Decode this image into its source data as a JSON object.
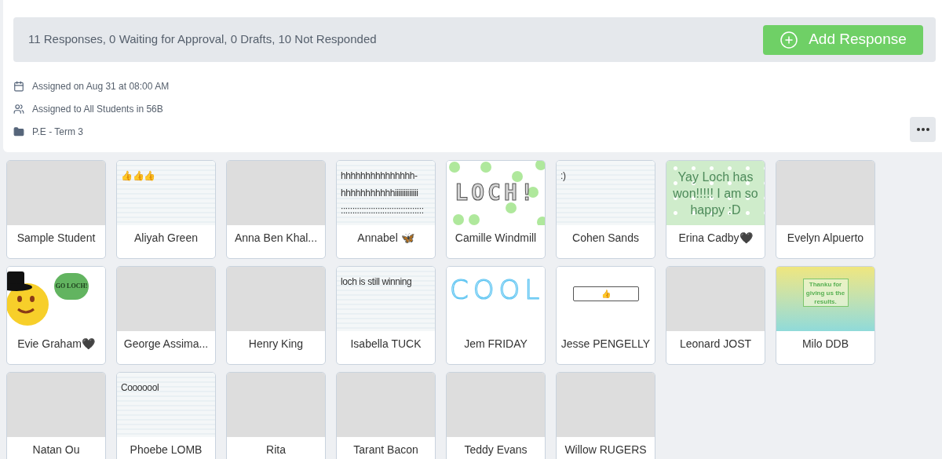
{
  "summary": {
    "text": "11 Responses, 0 Waiting for Approval, 0 Drafts, 10 Not Responded",
    "add_button": "Add Response"
  },
  "meta": [
    {
      "kind": "calendar",
      "text": "Assigned on Aug 31 at 08:00 AM"
    },
    {
      "kind": "people",
      "text": "Assigned to All Students in 56B"
    },
    {
      "kind": "folder",
      "text": "P.E - Term 3"
    }
  ],
  "responses": [
    {
      "name": "Sample Student",
      "thumb": {
        "kind": "blank"
      }
    },
    {
      "name": "Aliyah Green",
      "thumb": {
        "kind": "lined",
        "lines": [
          "👍👍👍"
        ]
      }
    },
    {
      "name": "Anna Ben Khal...",
      "thumb": {
        "kind": "blank"
      }
    },
    {
      "name": "Annabel 🦋",
      "thumb": {
        "kind": "lined",
        "lines": [
          "hhhhhhhhhhhhhhh-",
          "hhhhhhhhhhhiiiiiiiiiiiii",
          "::::::::::::::::::::::::::::::::::::"
        ]
      }
    },
    {
      "name": "Camille Windmill",
      "thumb": {
        "kind": "bubbles",
        "text": "LOCH!"
      }
    },
    {
      "name": "Cohen Sands",
      "thumb": {
        "kind": "lined",
        "lines": [
          ":)"
        ]
      }
    },
    {
      "name": "Erina Cadby🖤",
      "thumb": {
        "kind": "snow",
        "text": "Yay Loch has won!!!!! I am so happy :D"
      }
    },
    {
      "name": "Evelyn Alpuerto",
      "thumb": {
        "kind": "blank"
      }
    },
    {
      "name": "Evie Graham🖤",
      "thumb": {
        "kind": "smiley",
        "text": "GO LOCH!"
      }
    },
    {
      "name": "George Assima...",
      "thumb": {
        "kind": "blank"
      }
    },
    {
      "name": "Henry King",
      "thumb": {
        "kind": "blank"
      }
    },
    {
      "name": "Isabella TUCK",
      "thumb": {
        "kind": "lined",
        "lines": [
          "loch is still winning"
        ]
      }
    },
    {
      "name": "Jem FRIDAY",
      "thumb": {
        "kind": "handwriting",
        "text": "COOL"
      }
    },
    {
      "name": "Jesse PENGELLY",
      "thumb": {
        "kind": "boxed",
        "text": "👍"
      }
    },
    {
      "name": "Leonard JOST",
      "thumb": {
        "kind": "blank"
      }
    },
    {
      "name": "Milo DDB",
      "thumb": {
        "kind": "gradient",
        "text": "Thanku for giving us the results."
      }
    },
    {
      "name": "Natan Ou",
      "thumb": {
        "kind": "blank"
      }
    },
    {
      "name": "Phoebe LOMB",
      "thumb": {
        "kind": "lined",
        "lines": [
          "Cooooool"
        ]
      }
    },
    {
      "name": "Rita",
      "thumb": {
        "kind": "blank"
      }
    },
    {
      "name": "Tarant Bacon",
      "thumb": {
        "kind": "blank"
      }
    },
    {
      "name": "Teddy Evans",
      "thumb": {
        "kind": "blank"
      }
    },
    {
      "name": "Willow RUGERS",
      "thumb": {
        "kind": "blank"
      }
    }
  ]
}
